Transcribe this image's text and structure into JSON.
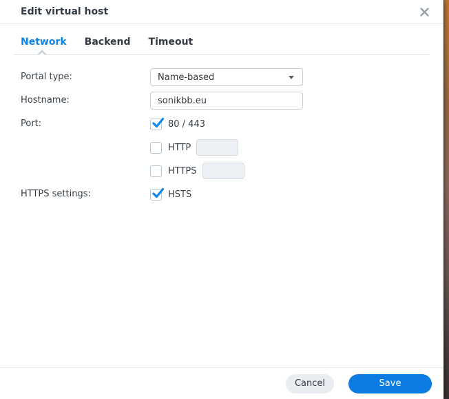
{
  "dialog": {
    "title": "Edit virtual host"
  },
  "tabs": [
    {
      "label": "Network",
      "active": true
    },
    {
      "label": "Backend",
      "active": false
    },
    {
      "label": "Timeout",
      "active": false
    }
  ],
  "form": {
    "portal_type": {
      "label": "Portal type:",
      "value": "Name-based"
    },
    "hostname": {
      "label": "Hostname:",
      "value": "sonikbb.eu"
    },
    "port": {
      "label": "Port:",
      "options": [
        {
          "label": "80 / 443",
          "checked": true,
          "has_input": false,
          "input_value": ""
        },
        {
          "label": "HTTP",
          "checked": false,
          "has_input": true,
          "input_value": ""
        },
        {
          "label": "HTTPS",
          "checked": false,
          "has_input": true,
          "input_value": ""
        }
      ]
    },
    "https_settings": {
      "label": "HTTPS settings:",
      "options": [
        {
          "label": "HSTS",
          "checked": true
        }
      ]
    }
  },
  "footer": {
    "cancel_label": "Cancel",
    "save_label": "Save"
  },
  "colors": {
    "accent_blue": "#0a86ec",
    "save_button_blue": "#0c7ce2",
    "checkmark_blue": "#0f86e8",
    "wallpaper_strip_top": "#c1762b",
    "wallpaper_strip_middle": "#8a6a5e",
    "wallpaper_strip_bottom": "#382f31"
  }
}
